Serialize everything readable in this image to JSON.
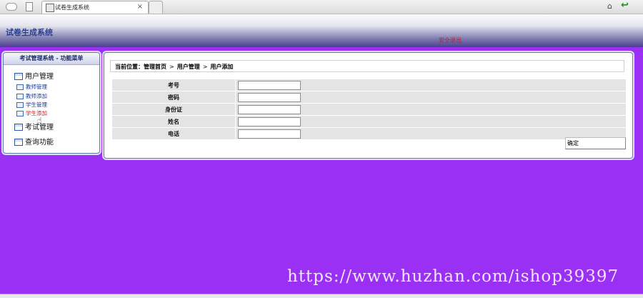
{
  "browser": {
    "tab_title": "试卷生成系统",
    "close_glyph": "×"
  },
  "header": {
    "title": "试卷生成系统",
    "logout": "安全退出"
  },
  "sidebar": {
    "title": "考试管理系统 - 功能菜单",
    "groups": [
      {
        "label": "用户管理",
        "items": [
          "教师管理",
          "教师添加",
          "学生管理",
          "学生添加"
        ]
      },
      {
        "label": "考试管理"
      },
      {
        "label": "查询功能"
      }
    ],
    "active_item": "学生添加"
  },
  "breadcrumb": {
    "prefix": "当前位置：",
    "parts": [
      "管理首页",
      "用户管理",
      "用户添加"
    ],
    "separator": ">"
  },
  "form": {
    "fields": [
      {
        "label": "考号",
        "value": ""
      },
      {
        "label": "密码",
        "value": ""
      },
      {
        "label": "身份证",
        "value": ""
      },
      {
        "label": "姓名",
        "value": ""
      },
      {
        "label": "电话",
        "value": ""
      }
    ],
    "submit_label": "确定"
  },
  "watermark": "https://www.huzhan.com/ishop39397",
  "colors": {
    "background": "#9b30f5",
    "accent": "#2a3f8f",
    "logout": "#e0101a"
  }
}
